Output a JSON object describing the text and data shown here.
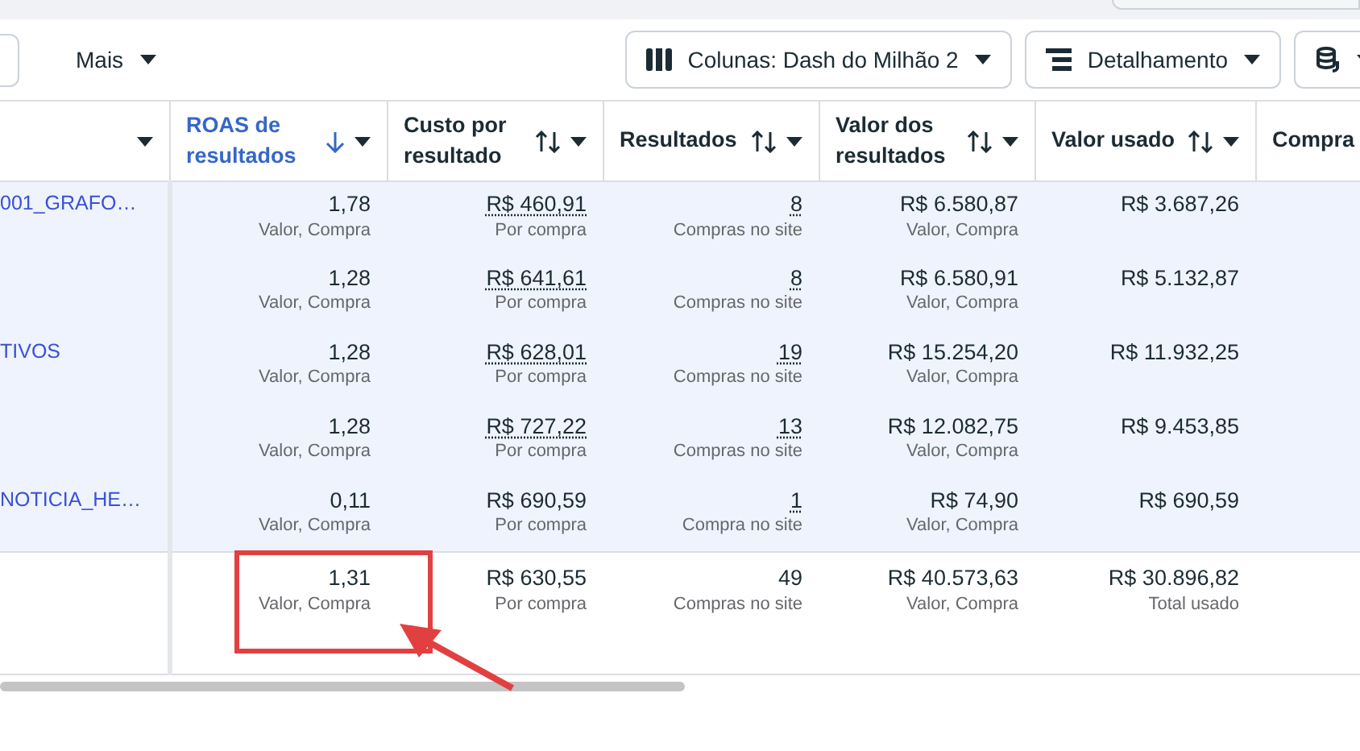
{
  "toolbar": {
    "more_button": "Mais",
    "columns_button": "Colunas: Dash do Milhão 2",
    "breakdown_button": "Detalhamento"
  },
  "table": {
    "columns": [
      {
        "label": "ROAS de resultados",
        "sortable": true,
        "sorted": true
      },
      {
        "label": "Custo por resultado",
        "sortable": true,
        "sorted": false
      },
      {
        "label": "Resultados",
        "sortable": true,
        "sorted": false
      },
      {
        "label": "Valor dos resultados",
        "sortable": true,
        "sorted": false
      },
      {
        "label": "Valor usado",
        "sortable": true,
        "sorted": false
      },
      {
        "label": "Compra",
        "sortable": false,
        "sorted": false
      }
    ],
    "rows": [
      {
        "name": "001_GRAFO…",
        "selected": true,
        "cells": [
          {
            "value": "1,78",
            "note": "Valor, Compra",
            "dotted": false
          },
          {
            "value": "R$ 460,91",
            "note": "Por compra",
            "dotted": true
          },
          {
            "value": "8",
            "note": "Compras no site",
            "dotted": true
          },
          {
            "value": "R$ 6.580,87",
            "note": "Valor, Compra",
            "dotted": false
          },
          {
            "value": "R$ 3.687,26",
            "dotted": false
          }
        ]
      },
      {
        "selected": true,
        "cells": [
          {
            "value": "1,28",
            "note": "Valor, Compra",
            "dotted": false
          },
          {
            "value": "R$ 641,61",
            "note": "Por compra",
            "dotted": true
          },
          {
            "value": "8",
            "note": "Compras no site",
            "dotted": true
          },
          {
            "value": "R$ 6.580,91",
            "note": "Valor, Compra",
            "dotted": false
          },
          {
            "value": "R$ 5.132,87",
            "dotted": false
          }
        ]
      },
      {
        "name": "TIVOS",
        "selected": true,
        "cells": [
          {
            "value": "1,28",
            "note": "Valor, Compra",
            "dotted": false
          },
          {
            "value": "R$ 628,01",
            "note": "Por compra",
            "dotted": true
          },
          {
            "value": "19",
            "note": "Compras no site",
            "dotted": true
          },
          {
            "value": "R$ 15.254,20",
            "note": "Valor, Compra",
            "dotted": false
          },
          {
            "value": "R$ 11.932,25",
            "dotted": false
          }
        ]
      },
      {
        "selected": true,
        "cells": [
          {
            "value": "1,28",
            "note": "Valor, Compra",
            "dotted": false
          },
          {
            "value": "R$ 727,22",
            "note": "Por compra",
            "dotted": true
          },
          {
            "value": "13",
            "note": "Compras no site",
            "dotted": true
          },
          {
            "value": "R$ 12.082,75",
            "note": "Valor, Compra",
            "dotted": false
          },
          {
            "value": "R$ 9.453,85",
            "dotted": false
          }
        ]
      },
      {
        "name": "NOTICIA_HE…",
        "selected": true,
        "cells": [
          {
            "value": "0,11",
            "note": "Valor, Compra",
            "dotted": false
          },
          {
            "value": "R$ 690,59",
            "note": "Por compra",
            "dotted": false
          },
          {
            "value": "1",
            "note": "Compra no site",
            "dotted": true
          },
          {
            "value": "R$ 74,90",
            "note": "Valor, Compra",
            "dotted": false
          },
          {
            "value": "R$ 690,59",
            "dotted": false
          }
        ]
      }
    ],
    "totals": [
      {
        "value": "1,31",
        "note": "Valor, Compra"
      },
      {
        "value": "R$ 630,55",
        "note": "Por compra"
      },
      {
        "value": "49",
        "note": "Compras no site"
      },
      {
        "value": "R$ 40.573,63",
        "note": "Valor, Compra"
      },
      {
        "value": "R$ 30.896,82",
        "note": "Total usado"
      }
    ]
  }
}
